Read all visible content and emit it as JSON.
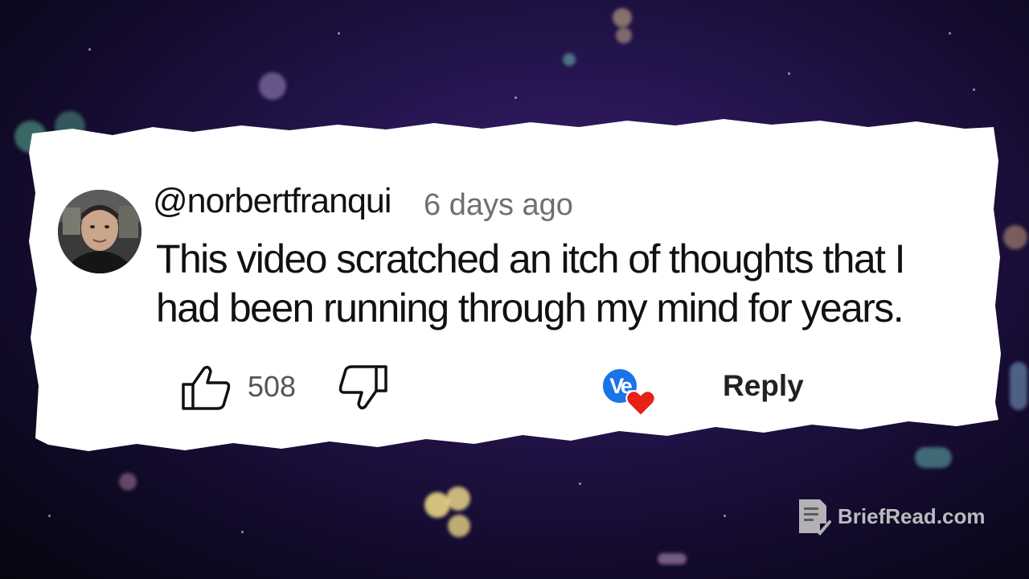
{
  "comment": {
    "username": "@norbertfranqui",
    "timestamp": "6 days ago",
    "text": "This video scratched an itch of thoughts that I had been running through my mind for years.",
    "like_count": "508",
    "reply_label": "Reply",
    "creator_heart_initials": "Ve"
  },
  "icons": {
    "like": "thumbs-up-icon",
    "dislike": "thumbs-down-icon",
    "heart": "heart-icon",
    "watermark": "document-check-icon"
  },
  "watermark": {
    "text": "BriefRead.com"
  },
  "colors": {
    "background": "#24144d",
    "paper": "#ffffff",
    "heart": "#e62117",
    "creator_badge": "#1a73e8",
    "timestamp": "#6f6f6f"
  }
}
